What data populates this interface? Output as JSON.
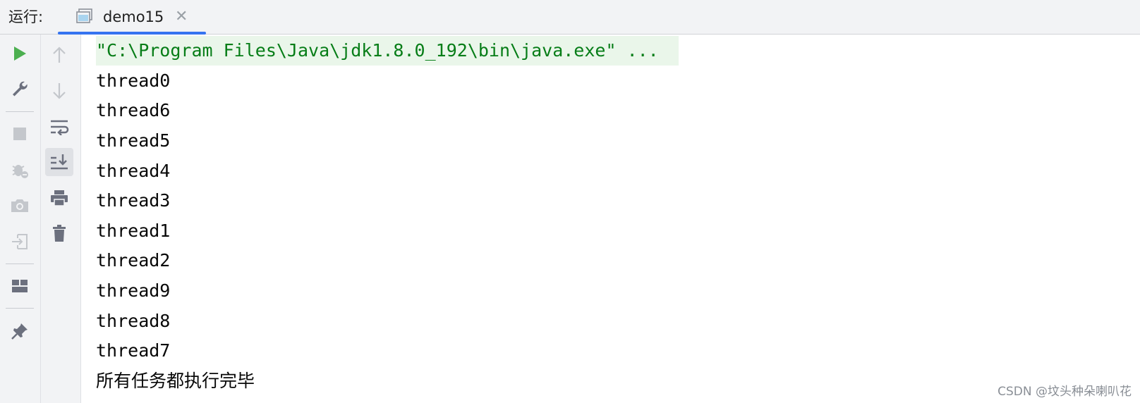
{
  "header": {
    "run_label": "运行:",
    "tab": {
      "title": "demo15",
      "close_symbol": "✕"
    },
    "accent_color": "#3574f0"
  },
  "toolbar_primary": {
    "items": [
      "rerun-icon",
      "wrench-icon",
      "stop-icon",
      "debug-icon",
      "camera-icon",
      "login-icon",
      "layout-icon",
      "pin-icon"
    ]
  },
  "toolbar_secondary": {
    "items": [
      "arrow-up-icon",
      "arrow-down-icon",
      "soft-wrap-icon",
      "scroll-to-end-icon",
      "print-icon",
      "trash-icon"
    ]
  },
  "console": {
    "command": "\"C:\\Program Files\\Java\\jdk1.8.0_192\\bin\\java.exe\" ...",
    "lines": [
      "thread0",
      "thread6",
      "thread5",
      "thread4",
      "thread3",
      "thread1",
      "thread2",
      "thread9",
      "thread8",
      "thread7"
    ],
    "final_message": "所有任务都执行完毕"
  },
  "watermark": "CSDN @坟头种朵喇叭花"
}
